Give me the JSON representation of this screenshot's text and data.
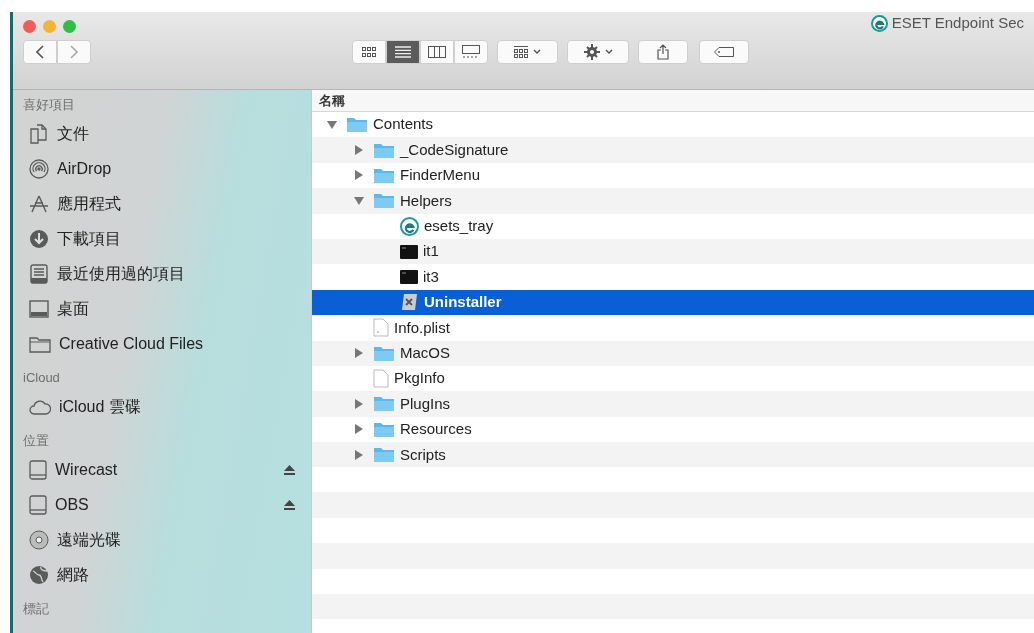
{
  "window": {
    "title": "ESET Endpoint Sec"
  },
  "toolbar": {
    "view_modes": [
      {
        "kind": "icons",
        "selected": false
      },
      {
        "kind": "list",
        "selected": true
      },
      {
        "kind": "columns",
        "selected": false
      },
      {
        "kind": "gallery",
        "selected": false
      }
    ]
  },
  "sidebar": {
    "sections": [
      {
        "title": "喜好項目",
        "items": [
          {
            "label": "文件",
            "kind": "documents"
          },
          {
            "label": "AirDrop",
            "kind": "airdrop"
          },
          {
            "label": "應用程式",
            "kind": "apps"
          },
          {
            "label": "下載項目",
            "kind": "downloads"
          },
          {
            "label": "最近使用過的項目",
            "kind": "recents"
          },
          {
            "label": "桌面",
            "kind": "desktop"
          },
          {
            "label": "Creative Cloud Files",
            "kind": "folder"
          }
        ]
      },
      {
        "title": "iCloud",
        "items": [
          {
            "label": "iCloud 雲碟",
            "kind": "cloud"
          }
        ]
      },
      {
        "title": "位置",
        "items": [
          {
            "label": "Wirecast",
            "kind": "disk",
            "ejectable": true
          },
          {
            "label": "OBS",
            "kind": "disk",
            "ejectable": true
          },
          {
            "label": "遠端光碟",
            "kind": "optical"
          },
          {
            "label": "網路",
            "kind": "network"
          }
        ]
      },
      {
        "title": "標記"
      }
    ]
  },
  "file_list": {
    "columns": [
      "名稱"
    ],
    "items": [
      {
        "name": "Contents",
        "kind": "folder",
        "expanded": true,
        "selected": false,
        "children": [
          {
            "name": "_CodeSignature",
            "kind": "folder",
            "expanded": false,
            "selected": false
          },
          {
            "name": "FinderMenu",
            "kind": "folder",
            "expanded": false,
            "selected": false
          },
          {
            "name": "Helpers",
            "kind": "folder",
            "expanded": true,
            "selected": false,
            "children": [
              {
                "name": "esets_tray",
                "kind": "eset",
                "selected": false
              },
              {
                "name": "it1",
                "kind": "exec",
                "selected": false
              },
              {
                "name": "it3",
                "kind": "exec",
                "selected": false
              },
              {
                "name": "Uninstaller",
                "kind": "uninstaller",
                "selected": true
              }
            ]
          },
          {
            "name": "Info.plist",
            "kind": "plist",
            "selected": false
          },
          {
            "name": "MacOS",
            "kind": "folder",
            "expanded": false,
            "selected": false
          },
          {
            "name": "PkgInfo",
            "kind": "file",
            "selected": false
          },
          {
            "name": "PlugIns",
            "kind": "folder",
            "expanded": false,
            "selected": false
          },
          {
            "name": "Resources",
            "kind": "folder",
            "expanded": false,
            "selected": false
          },
          {
            "name": "Scripts",
            "kind": "folder",
            "expanded": false,
            "selected": false
          }
        ]
      }
    ]
  }
}
